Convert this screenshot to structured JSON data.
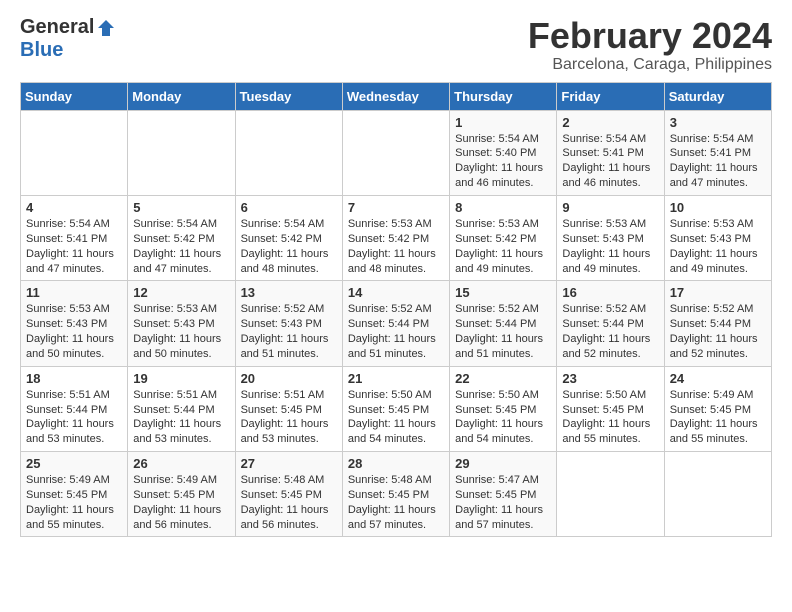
{
  "header": {
    "logo_general": "General",
    "logo_blue": "Blue",
    "title": "February 2024",
    "subtitle": "Barcelona, Caraga, Philippines"
  },
  "calendar": {
    "weekdays": [
      "Sunday",
      "Monday",
      "Tuesday",
      "Wednesday",
      "Thursday",
      "Friday",
      "Saturday"
    ],
    "weeks": [
      [
        {
          "day": "",
          "info": ""
        },
        {
          "day": "",
          "info": ""
        },
        {
          "day": "",
          "info": ""
        },
        {
          "day": "",
          "info": ""
        },
        {
          "day": "1",
          "info": "Sunrise: 5:54 AM\nSunset: 5:40 PM\nDaylight: 11 hours\nand 46 minutes."
        },
        {
          "day": "2",
          "info": "Sunrise: 5:54 AM\nSunset: 5:41 PM\nDaylight: 11 hours\nand 46 minutes."
        },
        {
          "day": "3",
          "info": "Sunrise: 5:54 AM\nSunset: 5:41 PM\nDaylight: 11 hours\nand 47 minutes."
        }
      ],
      [
        {
          "day": "4",
          "info": "Sunrise: 5:54 AM\nSunset: 5:41 PM\nDaylight: 11 hours\nand 47 minutes."
        },
        {
          "day": "5",
          "info": "Sunrise: 5:54 AM\nSunset: 5:42 PM\nDaylight: 11 hours\nand 47 minutes."
        },
        {
          "day": "6",
          "info": "Sunrise: 5:54 AM\nSunset: 5:42 PM\nDaylight: 11 hours\nand 48 minutes."
        },
        {
          "day": "7",
          "info": "Sunrise: 5:53 AM\nSunset: 5:42 PM\nDaylight: 11 hours\nand 48 minutes."
        },
        {
          "day": "8",
          "info": "Sunrise: 5:53 AM\nSunset: 5:42 PM\nDaylight: 11 hours\nand 49 minutes."
        },
        {
          "day": "9",
          "info": "Sunrise: 5:53 AM\nSunset: 5:43 PM\nDaylight: 11 hours\nand 49 minutes."
        },
        {
          "day": "10",
          "info": "Sunrise: 5:53 AM\nSunset: 5:43 PM\nDaylight: 11 hours\nand 49 minutes."
        }
      ],
      [
        {
          "day": "11",
          "info": "Sunrise: 5:53 AM\nSunset: 5:43 PM\nDaylight: 11 hours\nand 50 minutes."
        },
        {
          "day": "12",
          "info": "Sunrise: 5:53 AM\nSunset: 5:43 PM\nDaylight: 11 hours\nand 50 minutes."
        },
        {
          "day": "13",
          "info": "Sunrise: 5:52 AM\nSunset: 5:43 PM\nDaylight: 11 hours\nand 51 minutes."
        },
        {
          "day": "14",
          "info": "Sunrise: 5:52 AM\nSunset: 5:44 PM\nDaylight: 11 hours\nand 51 minutes."
        },
        {
          "day": "15",
          "info": "Sunrise: 5:52 AM\nSunset: 5:44 PM\nDaylight: 11 hours\nand 51 minutes."
        },
        {
          "day": "16",
          "info": "Sunrise: 5:52 AM\nSunset: 5:44 PM\nDaylight: 11 hours\nand 52 minutes."
        },
        {
          "day": "17",
          "info": "Sunrise: 5:52 AM\nSunset: 5:44 PM\nDaylight: 11 hours\nand 52 minutes."
        }
      ],
      [
        {
          "day": "18",
          "info": "Sunrise: 5:51 AM\nSunset: 5:44 PM\nDaylight: 11 hours\nand 53 minutes."
        },
        {
          "day": "19",
          "info": "Sunrise: 5:51 AM\nSunset: 5:44 PM\nDaylight: 11 hours\nand 53 minutes."
        },
        {
          "day": "20",
          "info": "Sunrise: 5:51 AM\nSunset: 5:45 PM\nDaylight: 11 hours\nand 53 minutes."
        },
        {
          "day": "21",
          "info": "Sunrise: 5:50 AM\nSunset: 5:45 PM\nDaylight: 11 hours\nand 54 minutes."
        },
        {
          "day": "22",
          "info": "Sunrise: 5:50 AM\nSunset: 5:45 PM\nDaylight: 11 hours\nand 54 minutes."
        },
        {
          "day": "23",
          "info": "Sunrise: 5:50 AM\nSunset: 5:45 PM\nDaylight: 11 hours\nand 55 minutes."
        },
        {
          "day": "24",
          "info": "Sunrise: 5:49 AM\nSunset: 5:45 PM\nDaylight: 11 hours\nand 55 minutes."
        }
      ],
      [
        {
          "day": "25",
          "info": "Sunrise: 5:49 AM\nSunset: 5:45 PM\nDaylight: 11 hours\nand 55 minutes."
        },
        {
          "day": "26",
          "info": "Sunrise: 5:49 AM\nSunset: 5:45 PM\nDaylight: 11 hours\nand 56 minutes."
        },
        {
          "day": "27",
          "info": "Sunrise: 5:48 AM\nSunset: 5:45 PM\nDaylight: 11 hours\nand 56 minutes."
        },
        {
          "day": "28",
          "info": "Sunrise: 5:48 AM\nSunset: 5:45 PM\nDaylight: 11 hours\nand 57 minutes."
        },
        {
          "day": "29",
          "info": "Sunrise: 5:47 AM\nSunset: 5:45 PM\nDaylight: 11 hours\nand 57 minutes."
        },
        {
          "day": "",
          "info": ""
        },
        {
          "day": "",
          "info": ""
        }
      ]
    ]
  }
}
